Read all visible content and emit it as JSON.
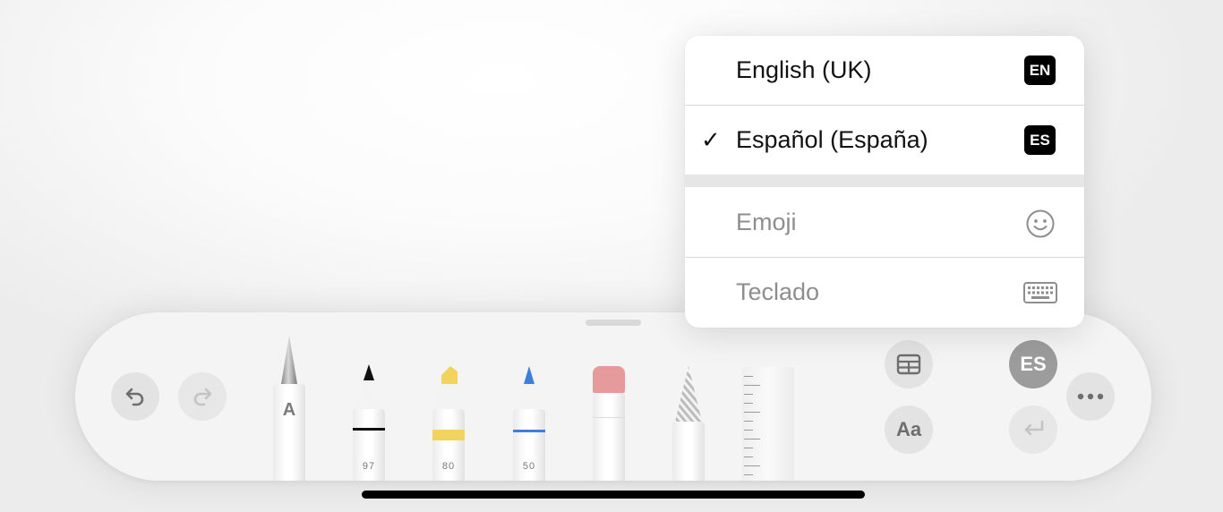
{
  "tools": {
    "pencil_a": {
      "letter": "A"
    },
    "pen": {
      "size": "97",
      "color": "#111111"
    },
    "marker": {
      "size": "80",
      "color": "#f1d35e"
    },
    "pen_blue": {
      "size": "50",
      "color": "#3f7fdc"
    },
    "eraser": {
      "color": "#e79a9c"
    }
  },
  "toolbar": {
    "language_button": "ES",
    "text_format_button": "Aa"
  },
  "menu": {
    "items": [
      {
        "label": "English (UK)",
        "badge": "EN",
        "checked": false
      },
      {
        "label": "Español (España)",
        "badge": "ES",
        "checked": true
      },
      {
        "label": "Emoji",
        "icon": "smiley-icon"
      },
      {
        "label": "Teclado",
        "icon": "keyboard-icon"
      }
    ],
    "check_mark": "✓"
  },
  "colors": {
    "toolbar_bg": "#f4f4f4",
    "button_bg": "#e3e3e3",
    "selected_language_bg": "#9c9c9c"
  }
}
